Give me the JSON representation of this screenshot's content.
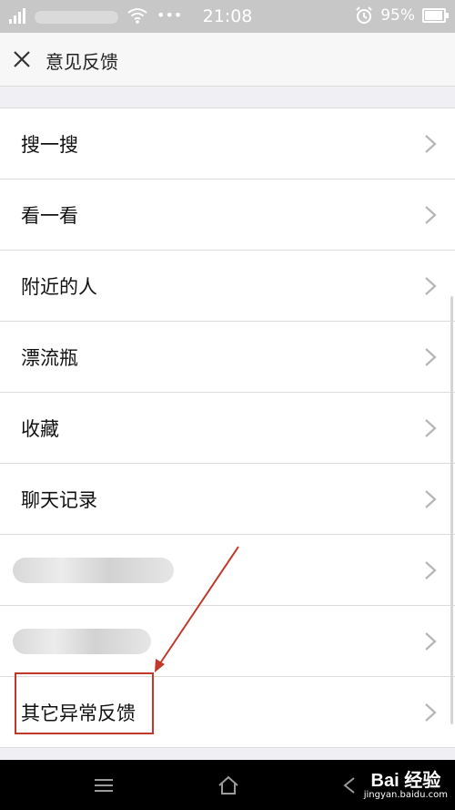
{
  "status_bar": {
    "time": "21:08",
    "battery": "95%",
    "battery_level": 0.95
  },
  "header": {
    "title": "意见反馈"
  },
  "list": {
    "items": [
      {
        "label": "搜一搜",
        "blurred": false
      },
      {
        "label": "看一看",
        "blurred": false
      },
      {
        "label": "附近的人",
        "blurred": false
      },
      {
        "label": "漂流瓶",
        "blurred": false
      },
      {
        "label": "收藏",
        "blurred": false
      },
      {
        "label": "聊天记录",
        "blurred": false
      },
      {
        "label": "",
        "blurred": true
      },
      {
        "label": "",
        "blurred": true
      },
      {
        "label": "其它异常反馈",
        "blurred": false
      }
    ]
  },
  "annotation": {
    "color": "#c0392b"
  },
  "watermark": {
    "main": "Bai 经验",
    "sub": "jingyan.baidu.com"
  }
}
